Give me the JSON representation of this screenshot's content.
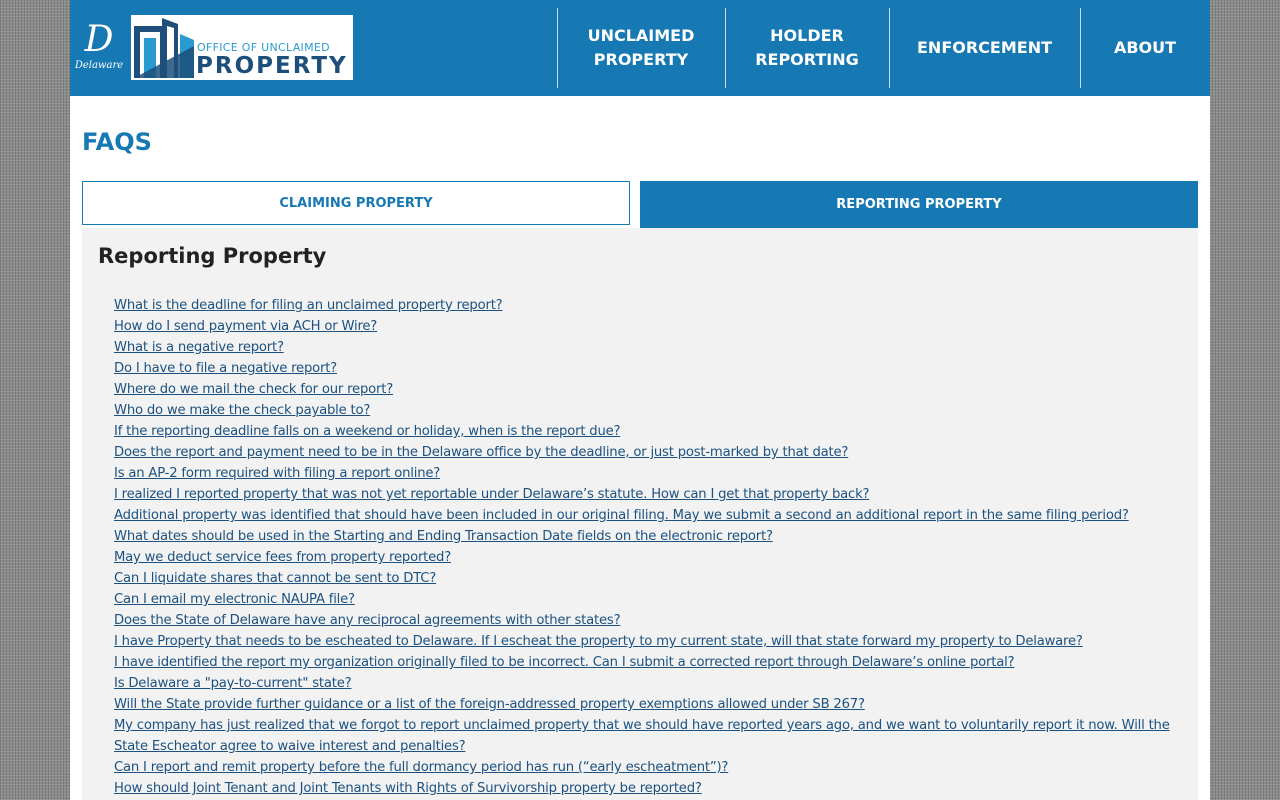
{
  "header": {
    "seal": {
      "letter": "D",
      "name": "Delaware",
      "icon": "delaware-seal-icon"
    },
    "logo": {
      "line1": "OFFICE OF UNCLAIMED",
      "line2": "PROPERTY",
      "icon": "building-logo-icon"
    },
    "nav": [
      {
        "label": "UNCLAIMED\nPROPERTY"
      },
      {
        "label": "HOLDER\nREPORTING"
      },
      {
        "label": "ENFORCEMENT"
      },
      {
        "label": "ABOUT"
      }
    ]
  },
  "page_title": "FAQS",
  "tabs": {
    "claiming": "CLAIMING PROPERTY",
    "reporting": "REPORTING PROPERTY",
    "active": "reporting"
  },
  "panel": {
    "title": "Reporting Property",
    "questions": [
      "What is the deadline for filing an unclaimed property report?",
      "How do I send payment via ACH or Wire?",
      "What is a negative report?",
      "Do I have to file a negative report?",
      "Where do we mail the check for our report?",
      "Who do we make the check payable to?",
      "If the reporting deadline falls on a weekend or holiday, when is the report due?",
      "Does the report and payment need to be in the Delaware office by the deadline, or just post-marked by that date?",
      "Is an AP-2 form required with filing a report online?",
      "I realized I reported property that was not yet reportable under Delaware’s statute. How can I get that property back?",
      "Additional property was identified that should have been included in our original filing. May we submit a second an additional report in the same filing period?",
      "What dates should be used in the Starting and Ending Transaction Date fields on the electronic report?",
      "May we deduct service fees from property reported?",
      "Can I liquidate shares that cannot be sent to DTC?",
      "Can I email my electronic NAUPA file?",
      "Does the State of Delaware have any reciprocal agreements with other states?",
      "I have Property that needs to be escheated to Delaware. If I escheat the property to my current state, will that state forward my property to Delaware?",
      "I have identified the report my organization originally filed to be incorrect. Can I submit a corrected report through Delaware’s online portal?",
      "Is Delaware a \"pay-to-current\" state?",
      "Will the State provide further guidance or a list of the foreign-addressed property exemptions allowed under SB 267?",
      "My company has just realized that we forgot to report unclaimed property that we should have reported years ago, and we want to voluntarily report it now. Will the State Escheator agree to waive interest and penalties?",
      "Can I report and remit property before the full dormancy period has run (“early escheatment”)?",
      "How should Joint Tenant and Joint Tenants with Rights of Survivorship property be reported?"
    ]
  },
  "colors": {
    "brand_blue": "#1779b4",
    "link": "#1d5280",
    "panel_bg": "#f2f2f2",
    "logo_navy": "#1d4f7a",
    "logo_light": "#2a9bd0"
  }
}
